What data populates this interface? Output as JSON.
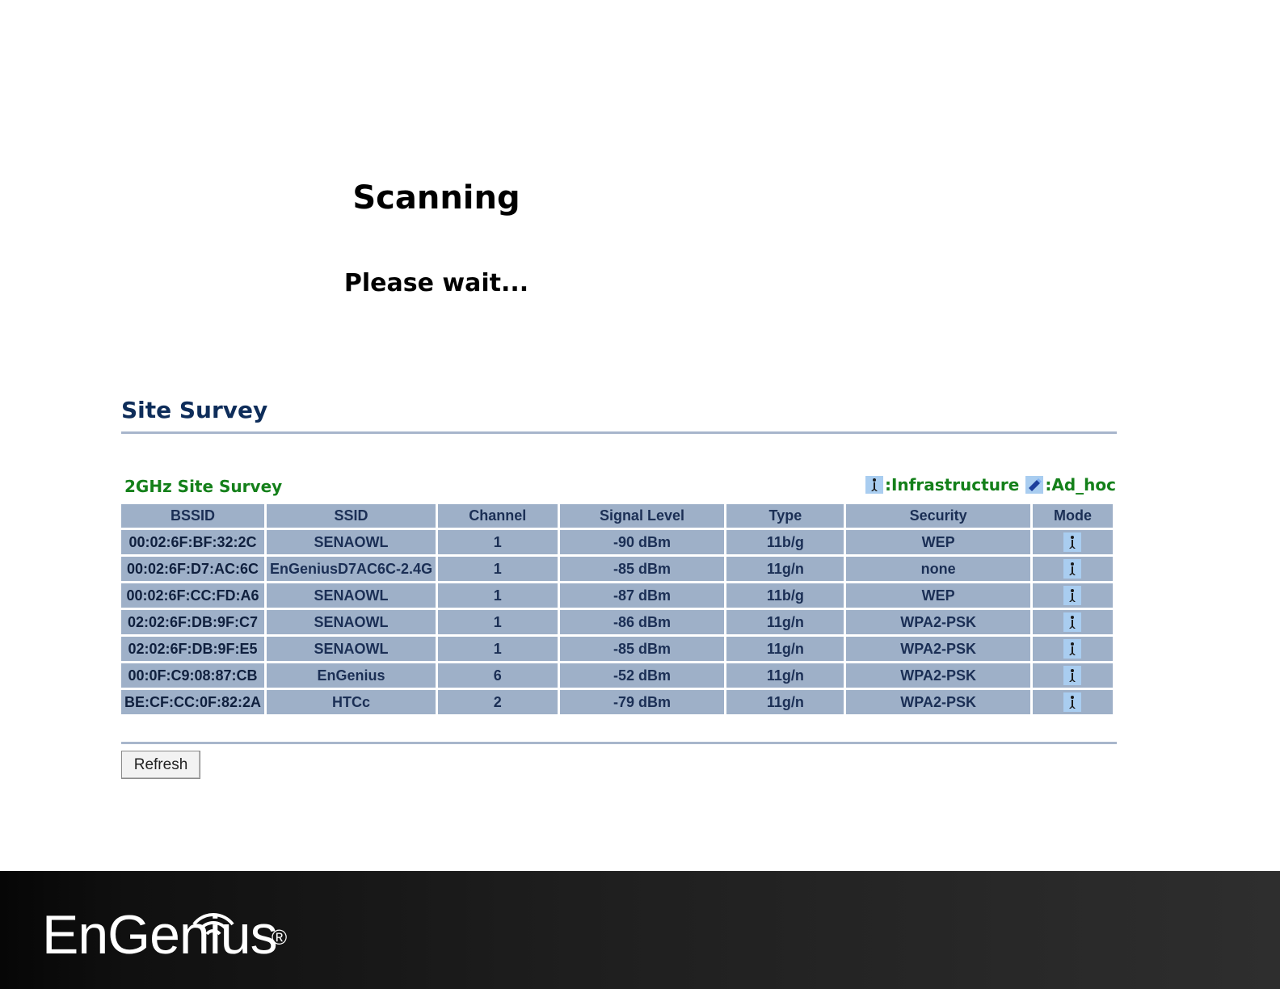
{
  "scanning": {
    "title": "Scanning",
    "subtitle": "Please wait..."
  },
  "site_survey": {
    "title": "Site Survey",
    "band_title": "2GHz Site Survey",
    "legend": {
      "infrastructure_label": ":Infrastructure",
      "infrastructure_icon": "infrastructure-icon",
      "adhoc_label": ":Ad_hoc",
      "adhoc_icon": "adhoc-icon"
    },
    "columns": [
      "BSSID",
      "SSID",
      "Channel",
      "Signal Level",
      "Type",
      "Security",
      "Mode"
    ],
    "rows": [
      {
        "bssid": "00:02:6F:BF:32:2C",
        "ssid": "SENAOWL",
        "channel": "1",
        "signal": "-90 dBm",
        "type": "11b/g",
        "security": "WEP",
        "mode": "infrastructure"
      },
      {
        "bssid": "00:02:6F:D7:AC:6C",
        "ssid": "EnGeniusD7AC6C-2.4G",
        "channel": "1",
        "signal": "-85 dBm",
        "type": "11g/n",
        "security": "none",
        "mode": "infrastructure"
      },
      {
        "bssid": "00:02:6F:CC:FD:A6",
        "ssid": "SENAOWL",
        "channel": "1",
        "signal": "-87 dBm",
        "type": "11b/g",
        "security": "WEP",
        "mode": "infrastructure"
      },
      {
        "bssid": "02:02:6F:DB:9F:C7",
        "ssid": "SENAOWL",
        "channel": "1",
        "signal": "-86 dBm",
        "type": "11g/n",
        "security": "WPA2-PSK",
        "mode": "infrastructure"
      },
      {
        "bssid": "02:02:6F:DB:9F:E5",
        "ssid": "SENAOWL",
        "channel": "1",
        "signal": "-85 dBm",
        "type": "11g/n",
        "security": "WPA2-PSK",
        "mode": "infrastructure"
      },
      {
        "bssid": "00:0F:C9:08:87:CB",
        "ssid": "EnGenius",
        "channel": "6",
        "signal": "-52 dBm",
        "type": "11g/n",
        "security": "WPA2-PSK",
        "mode": "infrastructure"
      },
      {
        "bssid": "BE:CF:CC:0F:82:2A",
        "ssid": "HTCc",
        "channel": "2",
        "signal": "-79 dBm",
        "type": "11g/n",
        "security": "WPA2-PSK",
        "mode": "infrastructure"
      }
    ],
    "refresh_label": "Refresh"
  },
  "footer": {
    "brand": "EnGenius",
    "registered_mark": "®"
  },
  "colors": {
    "table_cell": "#9eb0c8",
    "heading_navy": "#0e2d5a",
    "band_green": "#14801a",
    "icon_bg": "#a9cdf0"
  }
}
